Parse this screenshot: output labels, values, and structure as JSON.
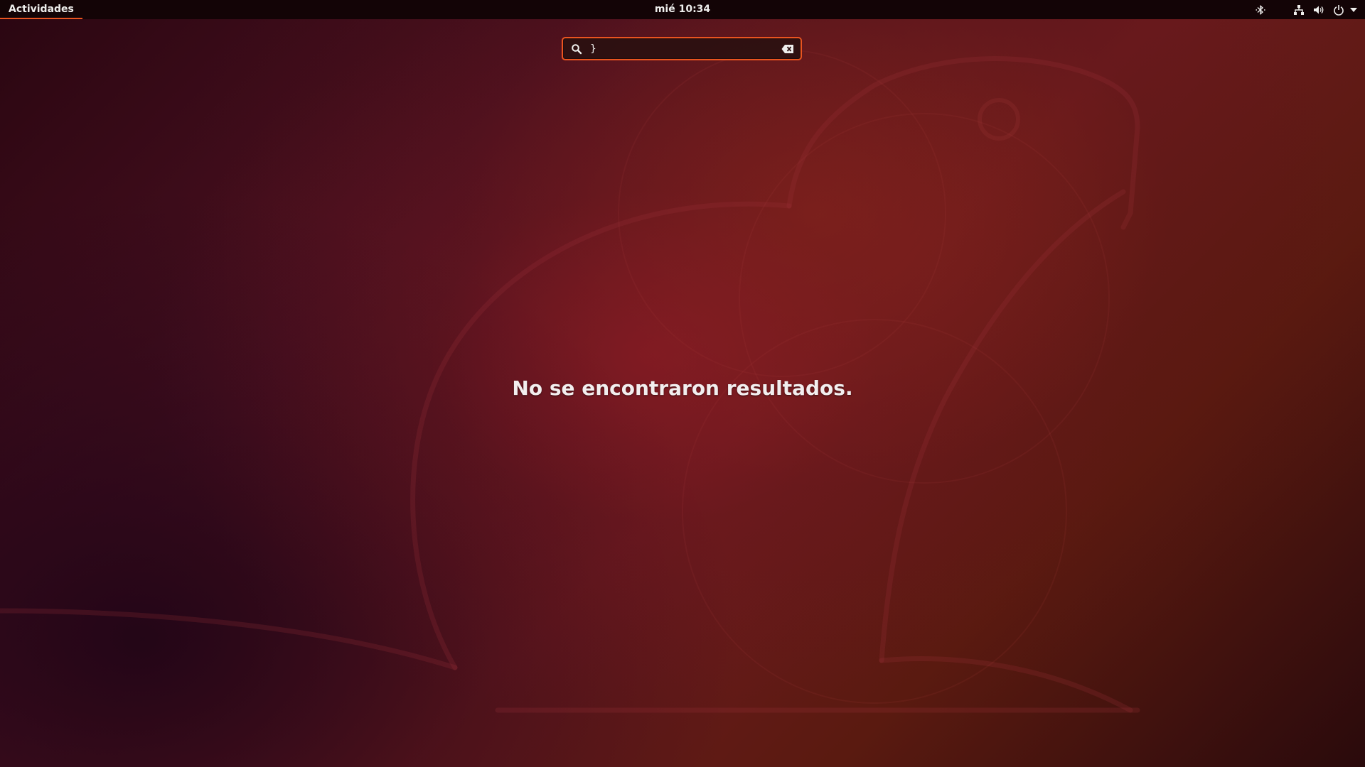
{
  "topbar": {
    "activities_label": "Actividades",
    "clock": "mié 10:34",
    "tray_icons": [
      "bluetooth-icon",
      "network-icon",
      "volume-icon",
      "power-icon",
      "menu-arrow-icon"
    ]
  },
  "search": {
    "value": "}",
    "icon": "search-icon",
    "clear_icon": "clear-text-icon"
  },
  "main": {
    "message": "No se encontraron resultados."
  },
  "colors": {
    "accent": "#e95420",
    "topbar": "#130406",
    "text": "#eeeeec"
  }
}
